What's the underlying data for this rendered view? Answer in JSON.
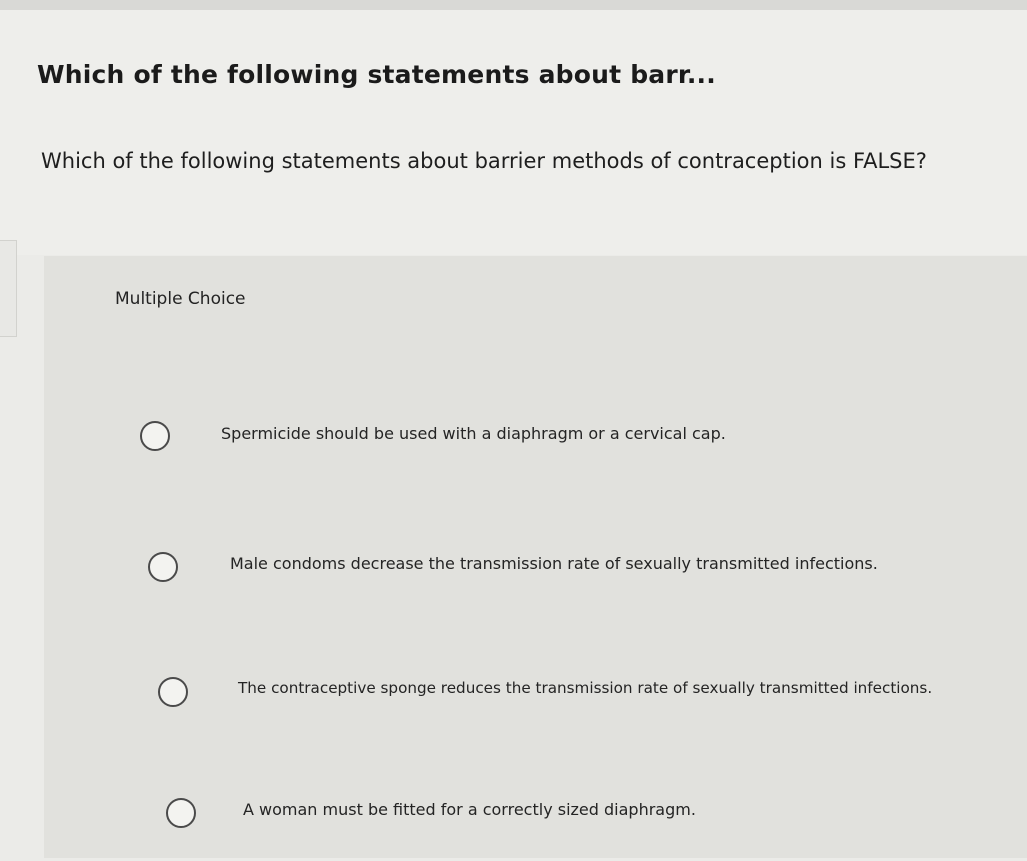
{
  "question": {
    "title": "Which of the following statements about barr...",
    "text": "Which of the following statements about barrier methods of contraception is FALSE?"
  },
  "choices": {
    "heading": "Multiple Choice",
    "options": [
      {
        "label": "Spermicide should be used with a diaphragm or a cervical cap.",
        "selected": false
      },
      {
        "label": "Male condoms decrease the transmission rate of sexually transmitted infections.",
        "selected": false
      },
      {
        "label": "The contraceptive sponge reduces the transmission rate of sexually transmitted infections.",
        "selected": false
      },
      {
        "label": "A woman must be fitted for a correctly sized diaphragm.",
        "selected": false
      }
    ]
  },
  "colors": {
    "background": "#ebebe8",
    "panel": "#e1e1dd",
    "text": "#1a1a1a",
    "radio_border": "#4a4a4a"
  }
}
